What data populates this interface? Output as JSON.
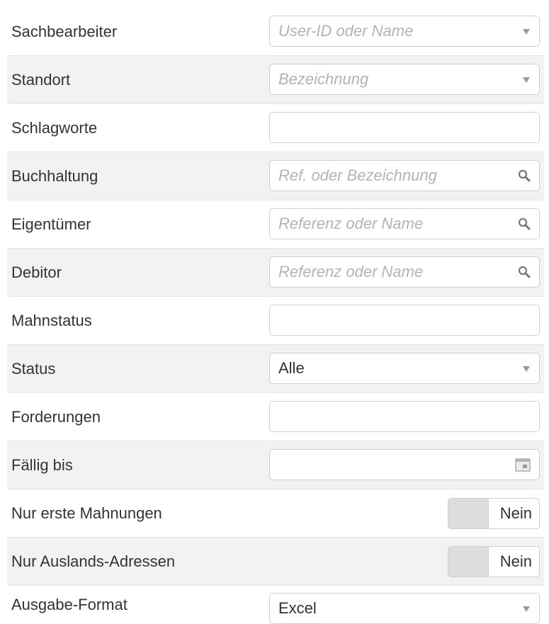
{
  "form": {
    "sachbearbeiter": {
      "label": "Sachbearbeiter",
      "placeholder": "User-ID oder Name",
      "value": ""
    },
    "standort": {
      "label": "Standort",
      "placeholder": "Bezeichnung",
      "value": ""
    },
    "schlagworte": {
      "label": "Schlagworte",
      "value": ""
    },
    "buchhaltung": {
      "label": "Buchhaltung",
      "placeholder": "Ref. oder Bezeichnung",
      "value": ""
    },
    "eigentuemer": {
      "label": "Eigentümer",
      "placeholder": "Referenz oder Name",
      "value": ""
    },
    "debitor": {
      "label": "Debitor",
      "placeholder": "Referenz oder Name",
      "value": ""
    },
    "mahnstatus": {
      "label": "Mahnstatus",
      "value": ""
    },
    "status": {
      "label": "Status",
      "value": "Alle"
    },
    "forderungen": {
      "label": "Forderungen",
      "value": ""
    },
    "faellig_bis": {
      "label": "Fällig bis",
      "value": ""
    },
    "nur_erste_mahnungen": {
      "label": "Nur erste Mahnungen",
      "value": "Nein"
    },
    "nur_auslands_adressen": {
      "label": "Nur Auslands-Adressen",
      "value": "Nein"
    },
    "ausgabe_format": {
      "label": "Ausgabe-Format",
      "value": "Excel"
    }
  },
  "icons": {
    "dropdown": "chevron-down-icon",
    "search": "search-icon",
    "calendar": "calendar-icon"
  },
  "colors": {
    "row_alt_bg": "#f2f2f2",
    "placeholder_text": "#b3b3b3",
    "field_border": "#cfcfcf",
    "toggle_off_bg": "#dcdcdc"
  }
}
